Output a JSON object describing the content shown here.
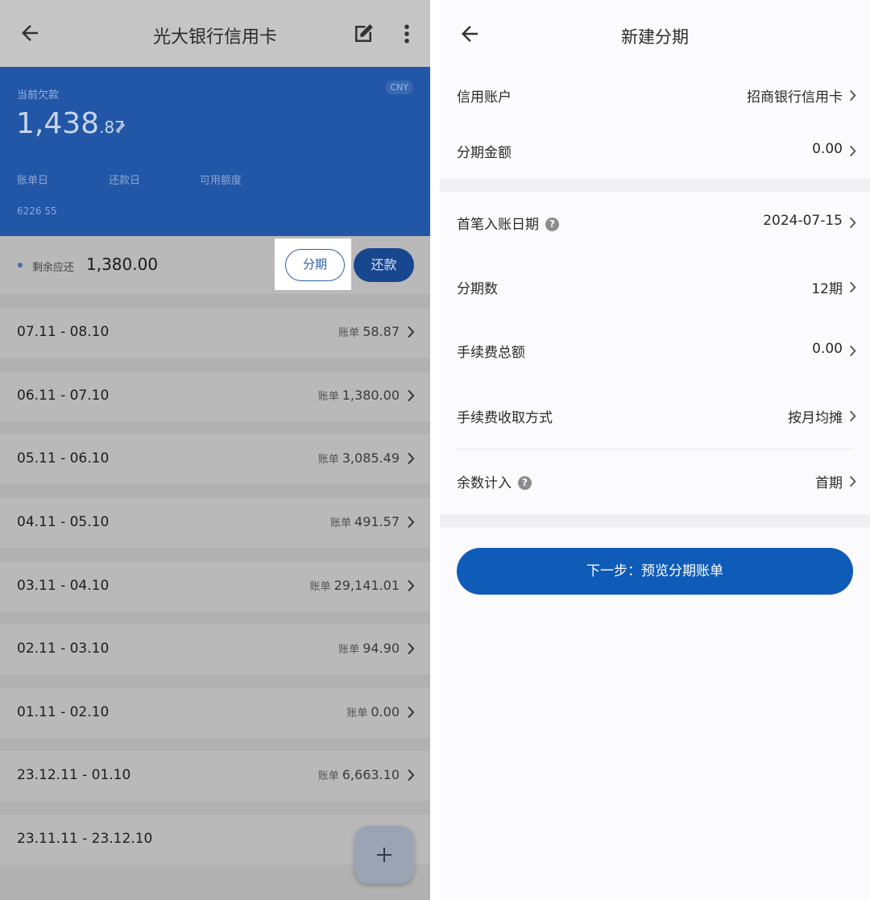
{
  "left": {
    "title": "光大银行信用卡",
    "hero": {
      "debt_label": "当前欠款",
      "currency": "CNY",
      "amount_int": "1,438",
      "amount_dec": ".87",
      "bill_day_label": "账单日",
      "repay_day_label": "还款日",
      "credit_label": "可用额度",
      "card_number": "6226 55"
    },
    "remain": {
      "label": "剩余应还",
      "value": "1,380.00",
      "installment_btn": "分期",
      "pay_btn": "还款"
    },
    "bill_label": "账单",
    "rows": [
      {
        "range": "07.11 - 08.10",
        "amount": "58.87"
      },
      {
        "range": "06.11 - 07.10",
        "amount": "1,380.00"
      },
      {
        "range": "05.11 - 06.10",
        "amount": "3,085.49"
      },
      {
        "range": "04.11 - 05.10",
        "amount": "491.57"
      },
      {
        "range": "03.11 - 04.10",
        "amount": "29,141.01"
      },
      {
        "range": "02.11 - 03.10",
        "amount": "94.90"
      },
      {
        "range": "01.11 - 02.10",
        "amount": "0.00"
      },
      {
        "range": "23.12.11 - 01.10",
        "amount": "6,663.10"
      },
      {
        "range": "23.11.11 - 23.12.10",
        "amount": ""
      }
    ],
    "fab_icon": "plus-icon"
  },
  "right": {
    "title": "新建分期",
    "fields": [
      {
        "key": "信用账户",
        "value": "招商银行信用卡"
      },
      {
        "key": "分期金额",
        "value": "0.00"
      },
      {
        "key": "首笔入账日期",
        "value": "2024-07-15",
        "help": true
      },
      {
        "key": "分期数",
        "value": "12期"
      },
      {
        "key": "手续费总额",
        "value": "0.00"
      },
      {
        "key": "手续费收取方式",
        "value": "按月均摊"
      },
      {
        "key": "余数计入",
        "value": "首期",
        "help": true
      }
    ],
    "next_button": "下一步：预览分期账单"
  },
  "colors": {
    "hero_blue": "#2257a7",
    "primary_button": "#0f5bb8",
    "dim_overlay": "#b9b9b9"
  }
}
